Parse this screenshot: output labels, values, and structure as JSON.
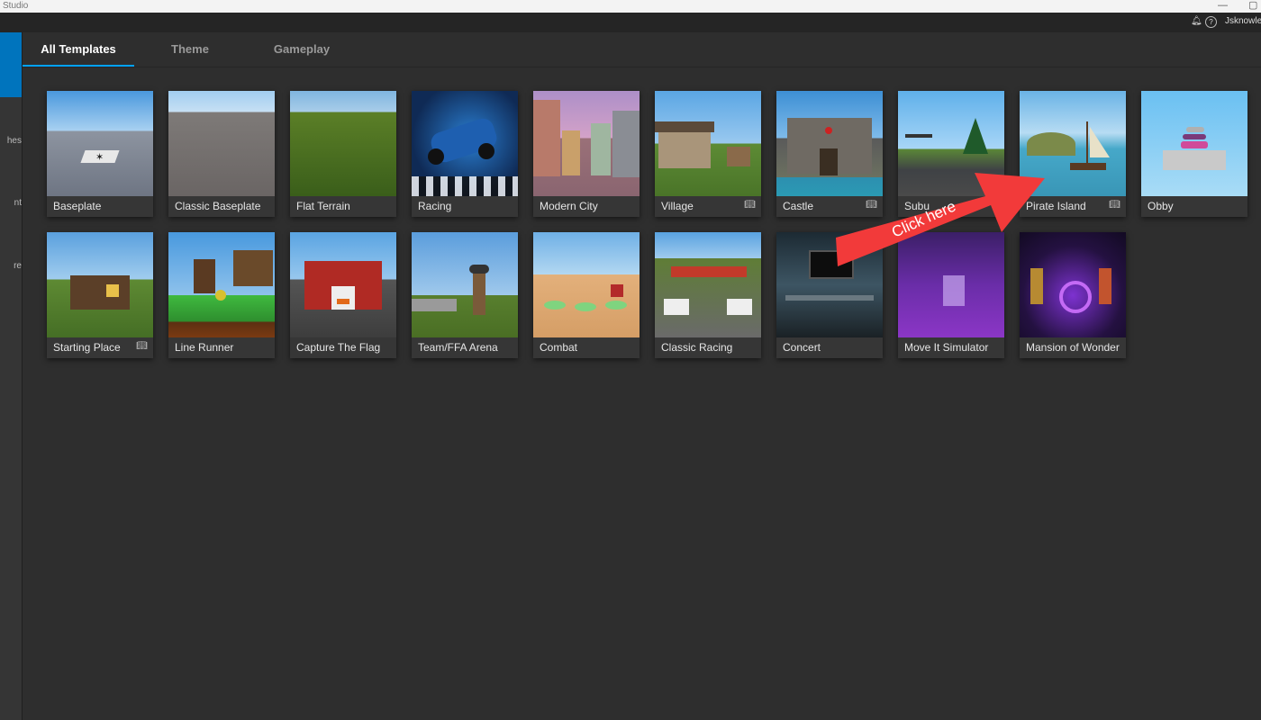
{
  "window": {
    "app_title": "Studio",
    "minimize": "—",
    "restore": "▢"
  },
  "topbar": {
    "username": "Jsknowled"
  },
  "sidebar": {
    "labels": [
      "hes",
      "nt",
      "re"
    ]
  },
  "tabs": [
    "All Templates",
    "Theme",
    "Gameplay"
  ],
  "templates": [
    {
      "name": "Baseplate",
      "has_book": false
    },
    {
      "name": "Classic Baseplate",
      "has_book": false
    },
    {
      "name": "Flat Terrain",
      "has_book": false
    },
    {
      "name": "Racing",
      "has_book": false
    },
    {
      "name": "Modern City",
      "has_book": false
    },
    {
      "name": "Village",
      "has_book": true
    },
    {
      "name": "Castle",
      "has_book": true
    },
    {
      "name": "Subu",
      "has_book": false
    },
    {
      "name": "Pirate Island",
      "has_book": true
    },
    {
      "name": "Obby",
      "has_book": false
    },
    {
      "name": "Starting Place",
      "has_book": true
    },
    {
      "name": "Line Runner",
      "has_book": false
    },
    {
      "name": "Capture The Flag",
      "has_book": false
    },
    {
      "name": "Team/FFA Arena",
      "has_book": false
    },
    {
      "name": "Combat",
      "has_book": false
    },
    {
      "name": "Classic Racing",
      "has_book": false
    },
    {
      "name": "Concert",
      "has_book": false
    },
    {
      "name": "Move It Simulator",
      "has_book": false
    },
    {
      "name": "Mansion of Wonder",
      "has_book": false
    }
  ],
  "annotation": {
    "text": "Click here",
    "color": "#f23a3a"
  },
  "colors": {
    "accent": "#00a2ff",
    "sidebar_selected": "#0074bd",
    "background": "#2e2e2e"
  }
}
